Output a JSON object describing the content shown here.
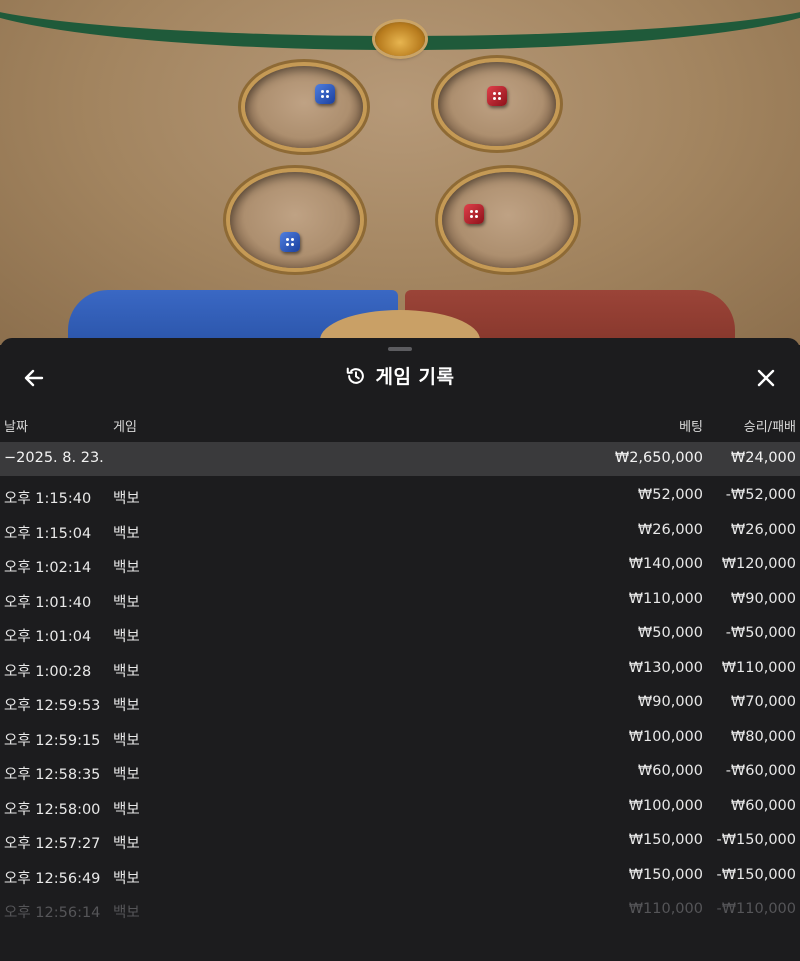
{
  "game_table": {
    "dice": [
      {
        "color": "blue"
      },
      {
        "color": "red"
      },
      {
        "color": "blue"
      },
      {
        "color": "red"
      }
    ]
  },
  "panel": {
    "title": "게임 기록",
    "icons": {
      "back": "arrow-left-icon",
      "history": "history-icon",
      "close": "close-icon"
    },
    "columns": {
      "date": "날짜",
      "game": "게임",
      "bet": "베팅",
      "win_loss": "승리/패배"
    },
    "date_group": {
      "date": "−2025. 8. 23.",
      "bet_total": "₩2,650,000",
      "win_loss_total": "₩24,000"
    },
    "rows": [
      {
        "time": "오후 1:15:40",
        "game": "백보",
        "bet": "₩52,000",
        "win_loss": "-₩52,000"
      },
      {
        "time": "오후 1:15:04",
        "game": "백보",
        "bet": "₩26,000",
        "win_loss": "₩26,000"
      },
      {
        "time": "오후 1:02:14",
        "game": "백보",
        "bet": "₩140,000",
        "win_loss": "₩120,000"
      },
      {
        "time": "오후 1:01:40",
        "game": "백보",
        "bet": "₩110,000",
        "win_loss": "₩90,000"
      },
      {
        "time": "오후 1:01:04",
        "game": "백보",
        "bet": "₩50,000",
        "win_loss": "-₩50,000"
      },
      {
        "time": "오후 1:00:28",
        "game": "백보",
        "bet": "₩130,000",
        "win_loss": "₩110,000"
      },
      {
        "time": "오후 12:59:53",
        "game": "백보",
        "bet": "₩90,000",
        "win_loss": "₩70,000"
      },
      {
        "time": "오후 12:59:15",
        "game": "백보",
        "bet": "₩100,000",
        "win_loss": "₩80,000"
      },
      {
        "time": "오후 12:58:35",
        "game": "백보",
        "bet": "₩60,000",
        "win_loss": "-₩60,000"
      },
      {
        "time": "오후 12:58:00",
        "game": "백보",
        "bet": "₩100,000",
        "win_loss": "₩60,000"
      },
      {
        "time": "오후 12:57:27",
        "game": "백보",
        "bet": "₩150,000",
        "win_loss": "-₩150,000"
      },
      {
        "time": "오후 12:56:49",
        "game": "백보",
        "bet": "₩150,000",
        "win_loss": "-₩150,000"
      },
      {
        "time": "오후 12:56:14",
        "game": "백보",
        "bet": "₩110,000",
        "win_loss": "-₩110,000"
      }
    ]
  }
}
